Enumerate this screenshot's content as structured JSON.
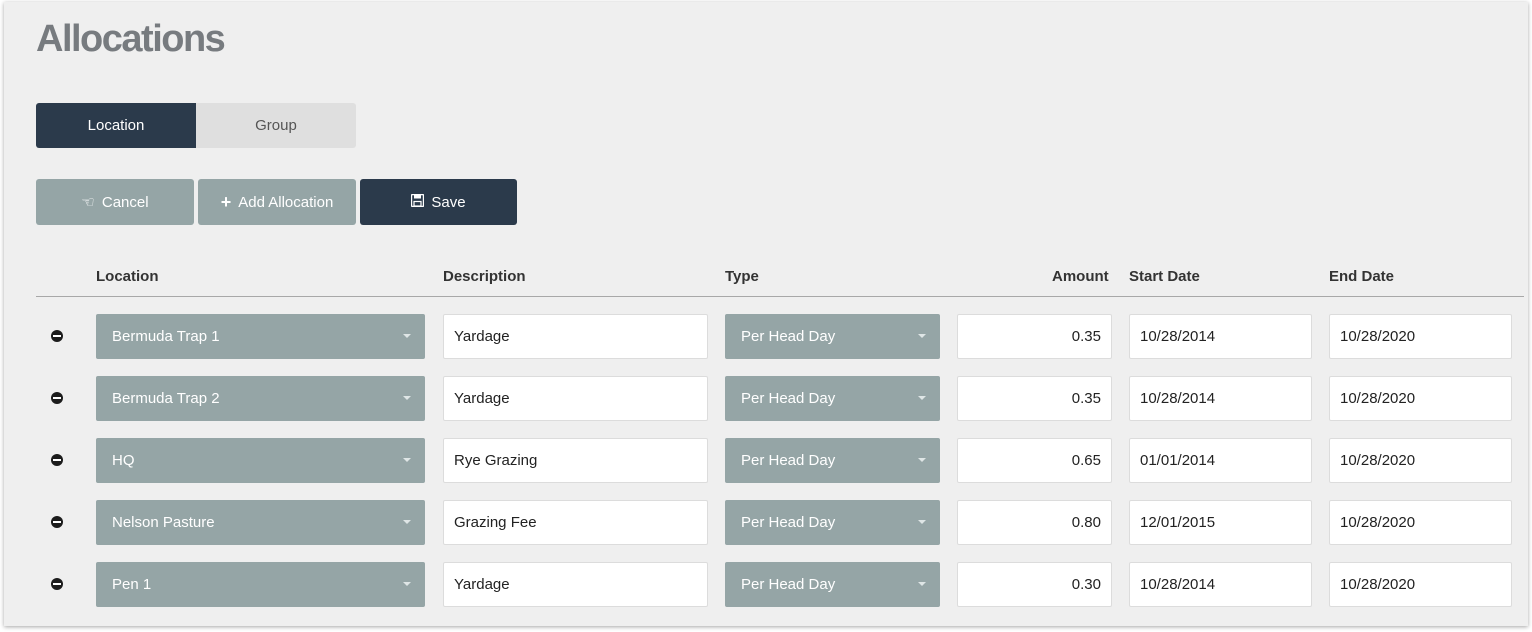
{
  "page": {
    "title": "Allocations"
  },
  "tabs": [
    {
      "label": "Location",
      "active": true
    },
    {
      "label": "Group",
      "active": false
    }
  ],
  "actions": {
    "cancel_label": "Cancel",
    "cancel_icon": "hand-pointing-left-icon",
    "add_label": "Add Allocation",
    "add_icon": "plus-icon",
    "save_label": "Save",
    "save_icon": "floppy-disk-icon"
  },
  "table": {
    "columns": {
      "location": "Location",
      "description": "Description",
      "type": "Type",
      "amount": "Amount",
      "start_date": "Start Date",
      "end_date": "End Date"
    },
    "rows": [
      {
        "location": "Bermuda Trap 1",
        "description": "Yardage",
        "type": "Per Head Day",
        "amount": "0.35",
        "start_date": "10/28/2014",
        "end_date": "10/28/2020"
      },
      {
        "location": "Bermuda Trap 2",
        "description": "Yardage",
        "type": "Per Head Day",
        "amount": "0.35",
        "start_date": "10/28/2014",
        "end_date": "10/28/2020"
      },
      {
        "location": "HQ",
        "description": "Rye Grazing",
        "type": "Per Head Day",
        "amount": "0.65",
        "start_date": "01/01/2014",
        "end_date": "10/28/2020"
      },
      {
        "location": "Nelson Pasture",
        "description": "Grazing Fee",
        "type": "Per Head Day",
        "amount": "0.80",
        "start_date": "12/01/2015",
        "end_date": "10/28/2020"
      },
      {
        "location": "Pen 1",
        "description": "Yardage",
        "type": "Per Head Day",
        "amount": "0.30",
        "start_date": "10/28/2014",
        "end_date": "10/28/2020"
      }
    ]
  },
  "colors": {
    "primary_dark": "#2b3a4b",
    "secondary_gray": "#95a5a6",
    "background": "#efefef"
  }
}
